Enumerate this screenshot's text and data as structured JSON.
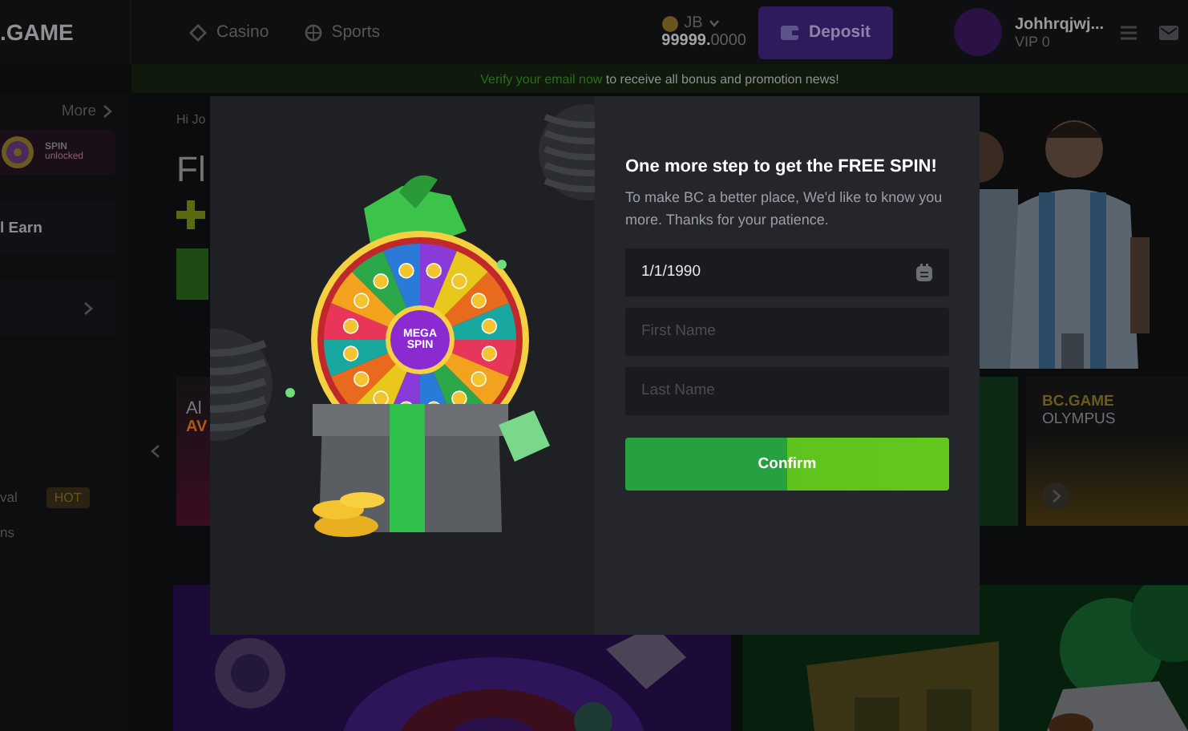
{
  "header": {
    "logo": ".GAME",
    "nav": [
      {
        "label": "Casino",
        "kind": "casino"
      },
      {
        "label": "Sports",
        "kind": "sports"
      }
    ],
    "wallet": {
      "currency": "JB",
      "balance": "**99999.**0000"
    },
    "deposit": "Deposit",
    "user": {
      "name": "Johhrqjwj...",
      "vip": "VIP 0"
    }
  },
  "notice": {
    "link": "Verify your email now",
    "text": " to receive all bonus and promotion news!"
  },
  "sidebar": {
    "more": "More",
    "spin": {
      "title": "SPIN",
      "subtitle": "unlocked"
    },
    "items": [
      {
        "kind": "card",
        "label": "l Earn"
      },
      {
        "kind": "chevron"
      },
      {
        "kind": "link",
        "label": "val",
        "badge": "HOT"
      },
      {
        "kind": "link",
        "label": "ns"
      }
    ]
  },
  "main": {
    "greeting": "Hi Jo",
    "headline": "Fl",
    "promo": {
      "title": "Al",
      "subtitle": "AV"
    },
    "featured": {
      "brand": "BC.GAME",
      "title": "OLYMPUS"
    }
  },
  "modal": {
    "illustration_label": "MEGA SPIN",
    "title": "One more step to get the FREE SPIN!",
    "description": "To make BC a better place, We'd like to know you more. Thanks for your patience.",
    "fields": [
      {
        "kind": "date",
        "value": "1/1/1990"
      },
      {
        "kind": "text",
        "placeholder": "First Name"
      },
      {
        "kind": "text",
        "placeholder": "Last Name"
      }
    ],
    "confirm": "Confirm"
  }
}
